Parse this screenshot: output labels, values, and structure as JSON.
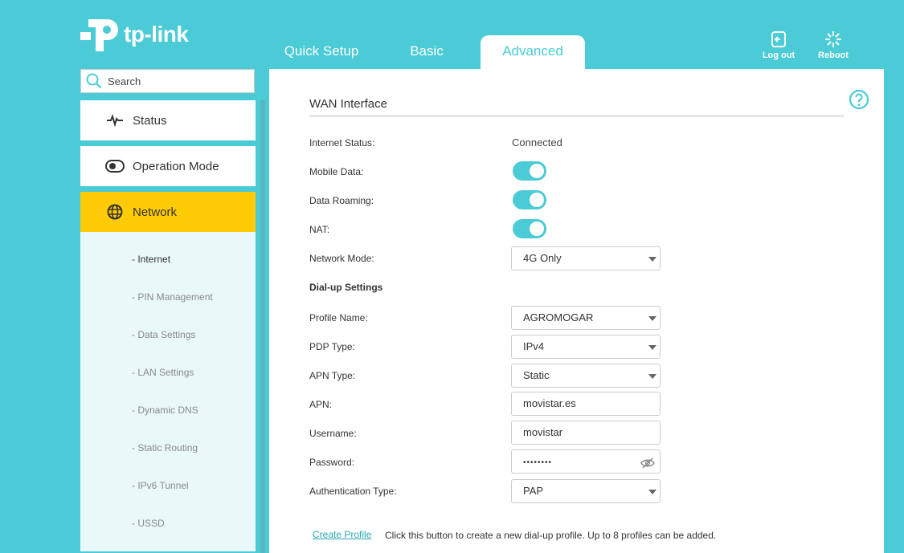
{
  "brand": {
    "logo_text": "tp-link",
    "accent": "#4acbd6",
    "highlight": "#ffcb05"
  },
  "top_tabs": [
    {
      "label": "Quick Setup"
    },
    {
      "label": "Basic"
    },
    {
      "label": "Advanced",
      "active": true
    }
  ],
  "top_actions": {
    "logout_label": "Log out",
    "reboot_label": "Reboot"
  },
  "search": {
    "placeholder": "Search"
  },
  "sidebar": {
    "items": [
      {
        "label": "Status",
        "icon": "pulse-icon"
      },
      {
        "label": "Operation Mode",
        "icon": "toggle-icon"
      },
      {
        "label": "Network",
        "icon": "globe-icon",
        "active": true
      }
    ],
    "subitems": [
      {
        "label": "- Internet",
        "active": true
      },
      {
        "label": "- PIN Management"
      },
      {
        "label": "- Data Settings"
      },
      {
        "label": "- LAN Settings"
      },
      {
        "label": "- Dynamic DNS"
      },
      {
        "label": "- Static Routing"
      },
      {
        "label": "- IPv6 Tunnel"
      },
      {
        "label": "- USSD"
      }
    ]
  },
  "wan": {
    "title": "WAN Interface",
    "internet_status_label": "Internet Status:",
    "internet_status_value": "Connected",
    "mobile_data_label": "Mobile Data:",
    "mobile_data_on": true,
    "data_roaming_label": "Data Roaming:",
    "data_roaming_on": true,
    "nat_label": "NAT:",
    "nat_on": true,
    "network_mode_label": "Network Mode:",
    "network_mode_value": "4G Only"
  },
  "dialup": {
    "title": "Dial-up Settings",
    "profile_name_label": "Profile Name:",
    "profile_name_value": "AGROMOGAR",
    "pdp_type_label": "PDP Type:",
    "pdp_type_value": "IPv4",
    "apn_type_label": "APN Type:",
    "apn_type_value": "Static",
    "apn_label": "APN:",
    "apn_value": "movistar.es",
    "username_label": "Username:",
    "username_value": "movistar",
    "password_label": "Password:",
    "password_value": "••••••••",
    "auth_type_label": "Authentication Type:",
    "auth_type_value": "PAP",
    "create_profile_label": "Create Profile",
    "create_profile_desc": "Click this button to create a new dial-up profile. Up to 8 profiles can be added."
  }
}
